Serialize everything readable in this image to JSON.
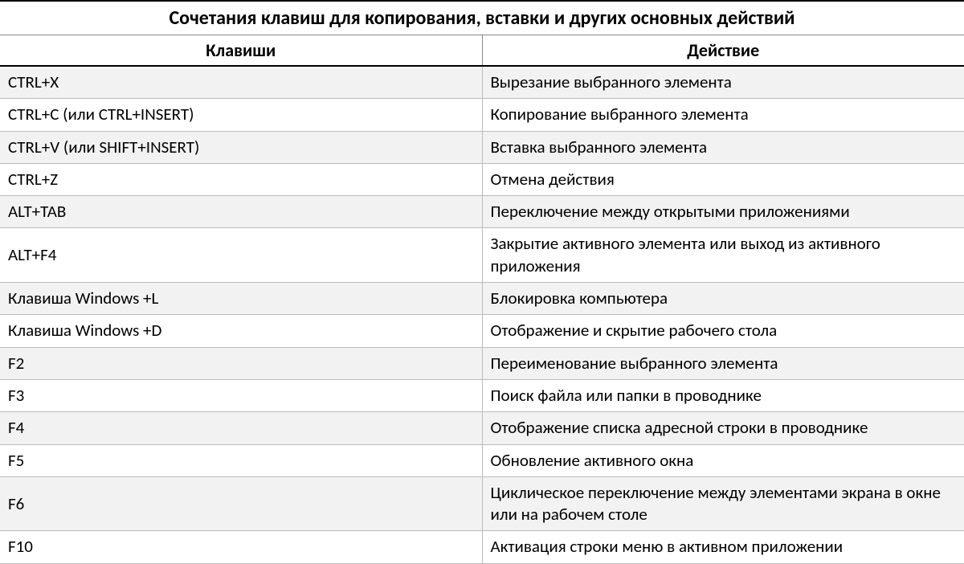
{
  "title": "Сочетания клавиш для копирования, вставки и других основных действий",
  "columns": {
    "keys": "Клавиши",
    "action": "Действие"
  },
  "rows": [
    {
      "keys": "CTRL+X",
      "action": "Вырезание выбранного элемента"
    },
    {
      "keys": "CTRL+C (или CTRL+INSERT)",
      "action": "Копирование выбранного элемента"
    },
    {
      "keys": "CTRL+V (или SHIFT+INSERT)",
      "action": "Вставка выбранного элемента"
    },
    {
      "keys": "CTRL+Z",
      "action": "Отмена действия"
    },
    {
      "keys": "ALT+TAB",
      "action": "Переключение между открытыми приложениями"
    },
    {
      "keys": "ALT+F4",
      "action": "Закрытие активного элемента или выход из активного приложения"
    },
    {
      "keys": "Клавиша Windows  +L",
      "action": "Блокировка компьютера"
    },
    {
      "keys": "Клавиша Windows  +D",
      "action": "Отображение и скрытие рабочего стола"
    },
    {
      "keys": "F2",
      "action": "Переименование выбранного элемента"
    },
    {
      "keys": "F3",
      "action": "Поиск файла или папки в проводнике"
    },
    {
      "keys": "F4",
      "action": "Отображение списка адресной строки в проводнике"
    },
    {
      "keys": "F5",
      "action": "Обновление активного окна"
    },
    {
      "keys": "F6",
      "action": "Циклическое переключение между элементами экрана в окне или на рабочем столе"
    },
    {
      "keys": "F10",
      "action": "Активация строки меню в активном приложении"
    }
  ]
}
